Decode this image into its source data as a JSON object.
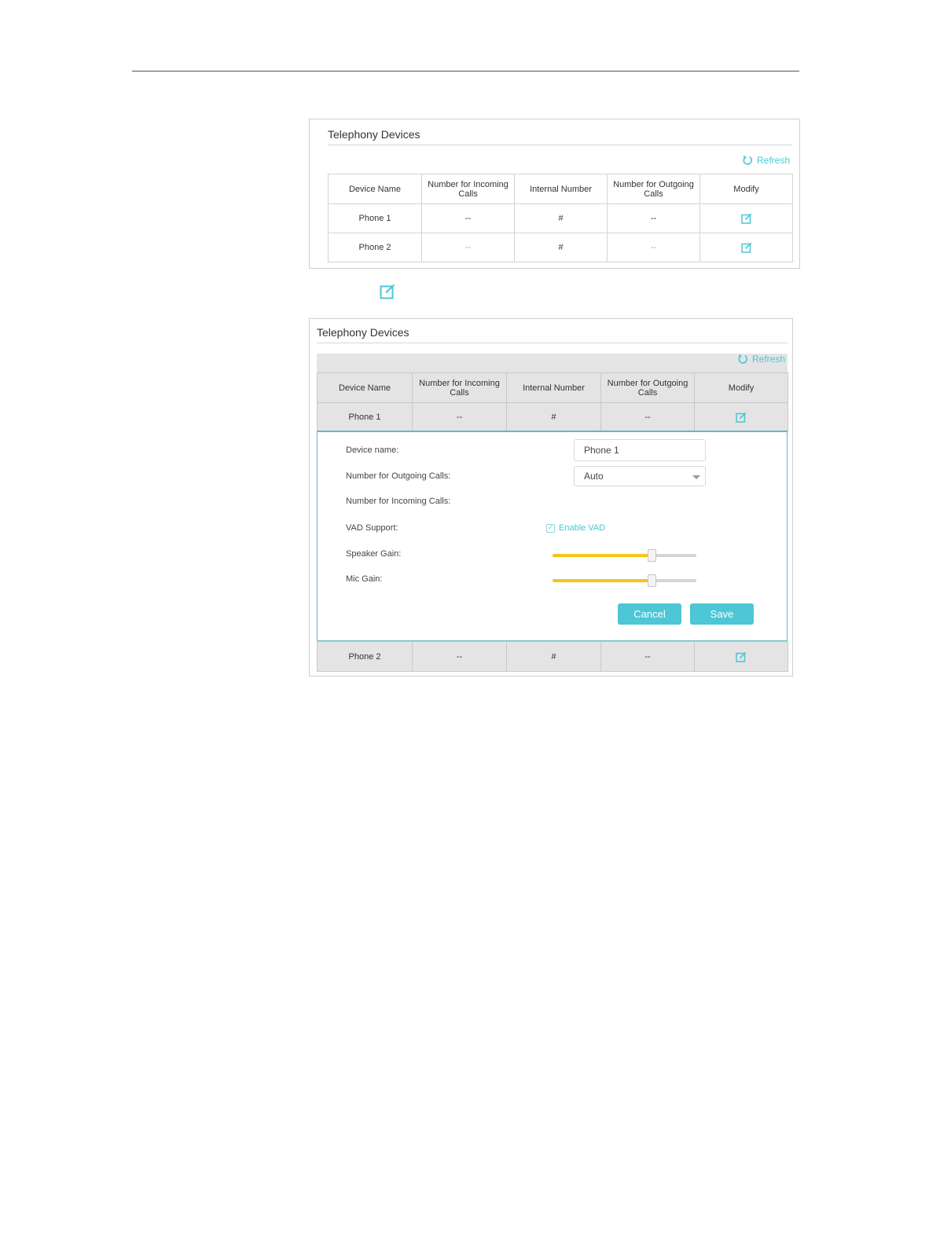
{
  "panel_title": "Telephony Devices",
  "refresh_label": "Refresh",
  "columns": [
    "Device Name",
    "Number for Incoming Calls",
    "Internal Number",
    "Number for Outgoing Calls",
    "Modify"
  ],
  "rows": [
    {
      "device_name": "Phone 1",
      "incoming": "--",
      "internal": "#",
      "outgoing": "--"
    },
    {
      "device_name": "Phone 2",
      "incoming": "--",
      "internal": "#",
      "outgoing": "--"
    }
  ],
  "icons": {
    "refresh": "refresh-icon",
    "modify": "edit-icon"
  },
  "colors": {
    "accent": "#4dc6d6",
    "slider_fill": "#f5c518",
    "edit_border": "#64b7c7"
  },
  "form": {
    "device_name_label": "Device name:",
    "device_name_value": "Phone 1",
    "outgoing_label": "Number for Outgoing Calls:",
    "outgoing_value": "Auto",
    "incoming_label": "Number for Incoming Calls:",
    "vad_label": "VAD Support:",
    "vad_checkbox_label": "Enable VAD",
    "vad_checked": true,
    "speaker_gain_label": "Speaker Gain:",
    "speaker_gain_level": 0.69,
    "mic_gain_label": "Mic Gain:",
    "mic_gain_level": 0.69,
    "cancel_label": "Cancel",
    "save_label": "Save"
  }
}
